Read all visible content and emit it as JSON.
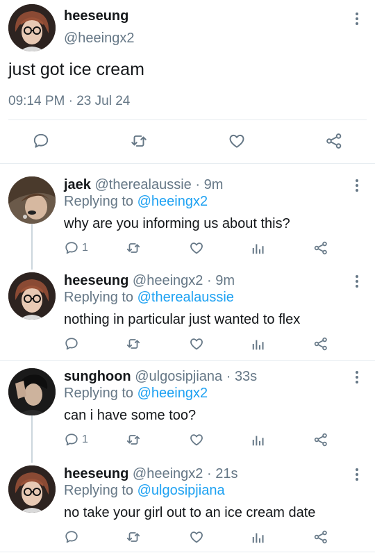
{
  "main_tweet": {
    "name": "heeseung",
    "handle": "@heeingx2",
    "text": "just got ice cream",
    "time": "09:14 PM",
    "separator": "·",
    "date": "23 Jul 24",
    "icons": [
      "comment-icon",
      "retweet-icon",
      "like-icon",
      "share-icon"
    ]
  },
  "replies": [
    {
      "name": "jaek",
      "handle": "@therealaussie",
      "time": "9m",
      "replying_prefix": "Replying to",
      "replying_to": "@heeingx2",
      "text": "why are you informing us about this?",
      "reply_count": "1"
    },
    {
      "name": "heeseung",
      "handle": "@heeingx2",
      "time": "9m",
      "replying_prefix": "Replying to",
      "replying_to": "@therealaussie",
      "text": "nothing in particular just wanted to flex",
      "reply_count": ""
    },
    {
      "name": "sunghoon",
      "handle": "@ulgosipjiana",
      "time": "33s",
      "replying_prefix": "Replying to",
      "replying_to": "@heeingx2",
      "text": "can i have some too?",
      "reply_count": "1"
    },
    {
      "name": "heeseung",
      "handle": "@heeingx2",
      "time": "21s",
      "replying_prefix": "Replying to",
      "replying_to": "@ulgosipjiana",
      "text": "no take your girl out to an ice cream date",
      "reply_count": ""
    }
  ],
  "colors": {
    "text": "#14171a",
    "muted": "#657786",
    "link": "#1da1f2",
    "border": "#e6ecf0"
  }
}
